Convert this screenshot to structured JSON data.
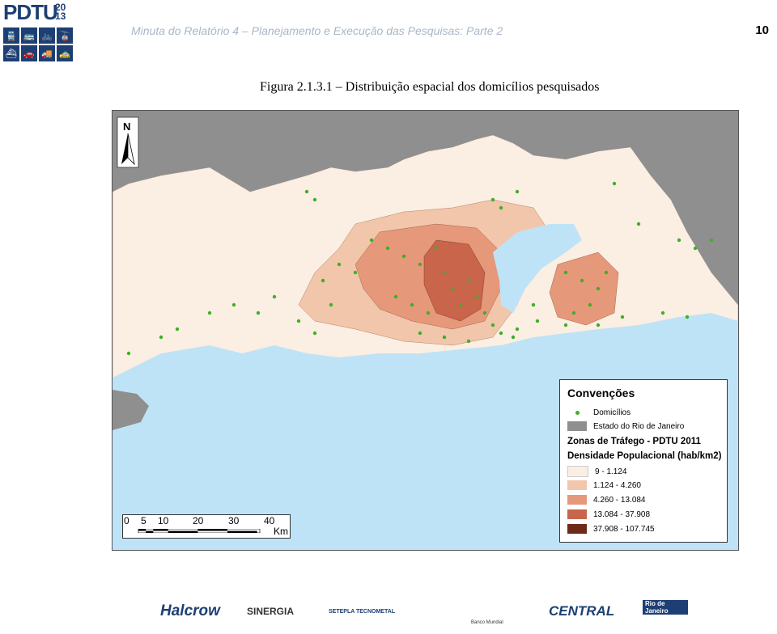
{
  "header": {
    "logo_text": "PDTU",
    "logo_year_top": "20",
    "logo_year_bottom": "13",
    "title": "Minuta do Relatório 4 – Planejamento e Execução das Pesquisas: Parte 2",
    "page_number": "10"
  },
  "figure": {
    "caption": "Figura 2.1.3.1 – Distribuição espacial dos domicílios pesquisados",
    "north_label": "N"
  },
  "legend": {
    "title": "Convenções",
    "items": [
      {
        "label": "Domicílios",
        "color": "#3fae2a"
      },
      {
        "label": "Estado do Rio de Janeiro",
        "color": "#8f8f8f"
      }
    ],
    "subtitle1": "Zonas de Tráfego - PDTU 2011",
    "subtitle2": "Densidade Populacional (hab/km2)",
    "classes": [
      {
        "label": "9 - 1.124",
        "color": "#fbeee2"
      },
      {
        "label": "1.124 - 4.260",
        "color": "#f2c6ab"
      },
      {
        "label": "4.260 - 13.084",
        "color": "#e6987a"
      },
      {
        "label": "13.084 - 37.908",
        "color": "#c8654a"
      },
      {
        "label": "37.908 - 107.745",
        "color": "#6e2a17"
      }
    ]
  },
  "scale": {
    "ticks": [
      "0",
      "5",
      "10",
      "20",
      "30",
      "40"
    ],
    "unit": "Km"
  },
  "footer": {
    "logos": [
      "Halcrow",
      "SINERGIA",
      "SETEPLA TECNOMETAL",
      "Banco Mundial",
      "CENTRAL",
      "Rio de Janeiro"
    ]
  },
  "colors": {
    "sea": "#bfe3f6",
    "land_grey": "#8f8f8f",
    "brand": "#1d3f73"
  }
}
